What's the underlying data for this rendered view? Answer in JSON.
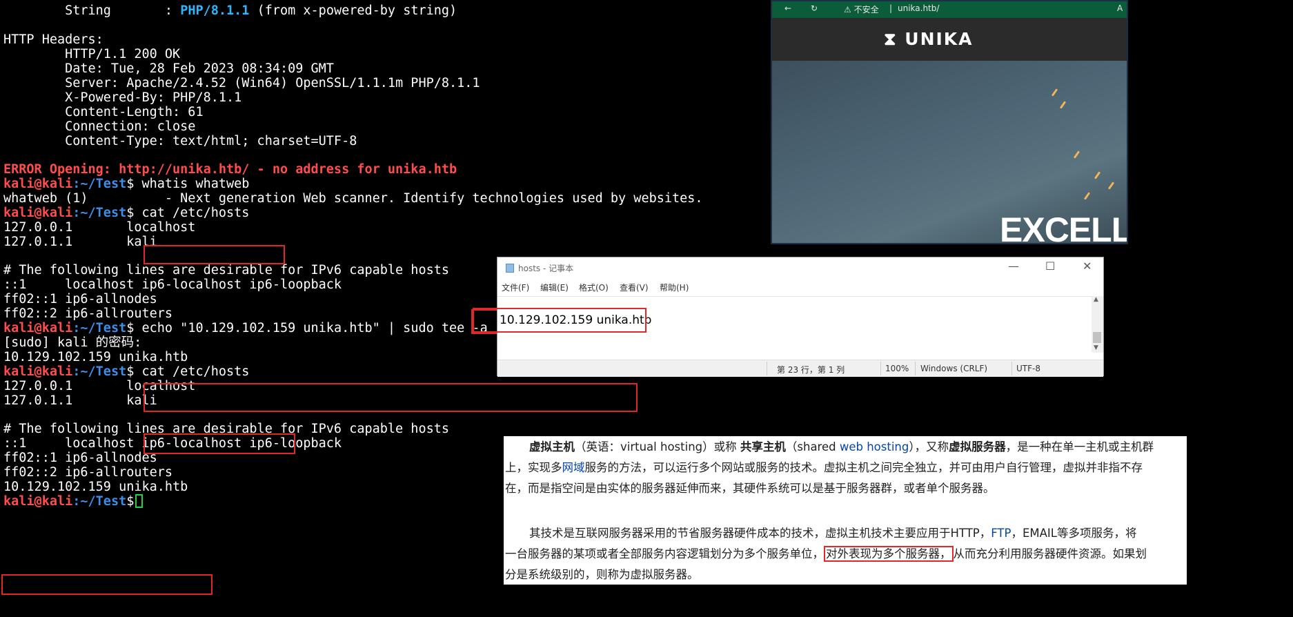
{
  "terminal": {
    "prompt_user": "kali@kali",
    "prompt_path": ":~/Test",
    "prompt_sym": "$",
    "l01_pre": "        String       : ",
    "l01_hl": "PHP/8.1.1",
    "l01_post": " (from x-powered-by string)",
    "l03": "HTTP Headers:",
    "l04": "        HTTP/1.1 200 OK",
    "l05": "        Date: Tue, 28 Feb 2023 08:34:09 GMT",
    "l06": "        Server: Apache/2.4.52 (Win64) OpenSSL/1.1.1m PHP/8.1.1",
    "l07": "        X-Powered-By: PHP/8.1.1",
    "l08": "        Content-Length: 61",
    "l09": "        Connection: close",
    "l10": "        Content-Type: text/html; charset=UTF-8",
    "l12": "ERROR Opening: http://unika.htb/ - no address for unika.htb",
    "l13_cmd": " whatis whatweb",
    "l14": "whatweb (1)          - Next generation Web scanner. Identify technologies used by websites.",
    "l15_cmd": " cat /etc/hosts",
    "l16": "127.0.0.1       localhost",
    "l17": "127.0.1.1       kali",
    "l19": "# The following lines are desirable for IPv6 capable hosts",
    "l20": "::1     localhost ip6-localhost ip6-loopback",
    "l21": "ff02::1 ip6-allnodes",
    "l22": "ff02::2 ip6-allrouters",
    "l23_cmd": " echo \"10.129.102.159 unika.htb\" | sudo tee -a /etc/hosts",
    "l24": "[sudo] kali 的密码:",
    "l25": "10.129.102.159 unika.htb",
    "l26_cmd": " cat /etc/hosts",
    "l27": "127.0.0.1       localhost",
    "l28": "127.0.1.1       kali",
    "l30": "# The following lines are desirable for IPv6 capable hosts",
    "l31": "::1     localhost ip6-localhost ip6-loopback",
    "l32": "ff02::1 ip6-allnodes",
    "l33": "ff02::2 ip6-allrouters",
    "l34": "10.129.102.159 unika.htb"
  },
  "browser": {
    "back": "←",
    "reload": "↻",
    "security": "⚠ 不安全",
    "sep": "|",
    "url": "unika.htb/",
    "right": "A",
    "logo_mark": "⧗",
    "logo_text": "UNIKA",
    "hero_text": "EXCELLE"
  },
  "notepad": {
    "title": "hosts - 记事本",
    "min": "—",
    "max": "☐",
    "close": "✕",
    "menus": [
      "文件(F)",
      "编辑(E)",
      "格式(O)",
      "查看(V)",
      "帮助(H)"
    ],
    "content": "10.129.102.159 unika.htb",
    "status_pos": "第 23 行，第 1 列",
    "status_zoom": "100%",
    "status_eol": "Windows (CRLF)",
    "status_enc": "UTF-8",
    "scroll_up": "▲",
    "scroll_down": "▼"
  },
  "wiki": {
    "p1a_b": "虚拟主机",
    "p1a_1": "（英语：virtual hosting）或称 ",
    "p1a_b2": "共享主机",
    "p1a_2": "（shared ",
    "p1a_link": "web hosting",
    "p1a_3": "），又称",
    "p1a_b3": "虚拟服务器",
    "p1a_4": "，是一种在单一主机或主机群",
    "p1b_1": "上，实现多",
    "p1b_link": "网域",
    "p1b_2": "服务的方法，可以运行多个网站或服务的技术。虚拟主机之间完全独立，并可由用户自行管理，虚拟并非指不存",
    "p1c": "在，而是指空间是由实体的服务器延伸而来，其硬件系统可以是基于服务器群，或者单个服务器。",
    "p2a_1": "其技术是互联网服务器采用的节省服务器硬件成本的技术，虚拟主机技术主要应用于HTTP，",
    "p2a_link": "FTP",
    "p2a_2": "，EMAIL等多项服务，将",
    "p2b_1": "一台服务器的某项或者全部服务内容逻辑划分为多个服务单位，",
    "p2b_boxed": "对外表现为多个服务器，",
    "p2b_2": "从而充分利用服务器硬件资源。如果划",
    "p2c": "分是系统级别的，则称为虚拟服务器。"
  }
}
